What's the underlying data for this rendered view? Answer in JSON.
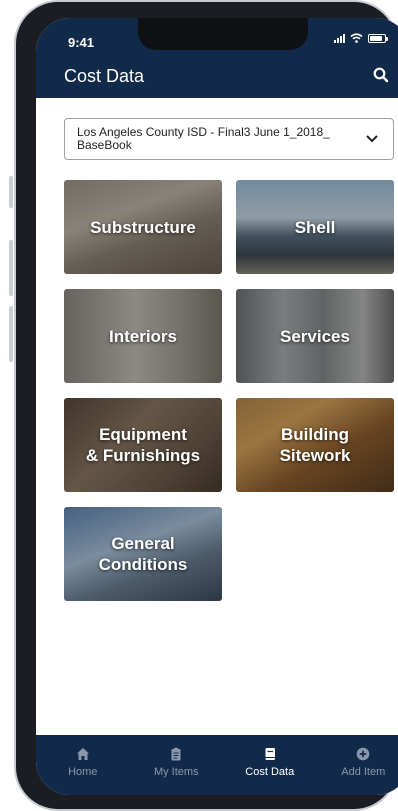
{
  "status_bar": {
    "time": "9:41"
  },
  "header": {
    "title": "Cost Data"
  },
  "book_select": {
    "value": "Los Angeles County ISD - Final3 June 1_2018_ BaseBook"
  },
  "categories": [
    {
      "label": "Substructure"
    },
    {
      "label": "Shell"
    },
    {
      "label": "Interiors"
    },
    {
      "label": "Services"
    },
    {
      "label": "Equipment\n& Furnishings"
    },
    {
      "label": "Building\nSitework"
    },
    {
      "label": "General\nConditions"
    }
  ],
  "tab_bar": {
    "items": [
      {
        "label": "Home",
        "icon": "home-icon"
      },
      {
        "label": "My Items",
        "icon": "clipboard-icon"
      },
      {
        "label": "Cost Data",
        "icon": "book-icon"
      },
      {
        "label": "Add Item",
        "icon": "plus-circle-icon"
      }
    ],
    "active": "Cost Data"
  },
  "colors": {
    "navy": "#122a4a",
    "tab_inactive": "#8a97ab"
  }
}
